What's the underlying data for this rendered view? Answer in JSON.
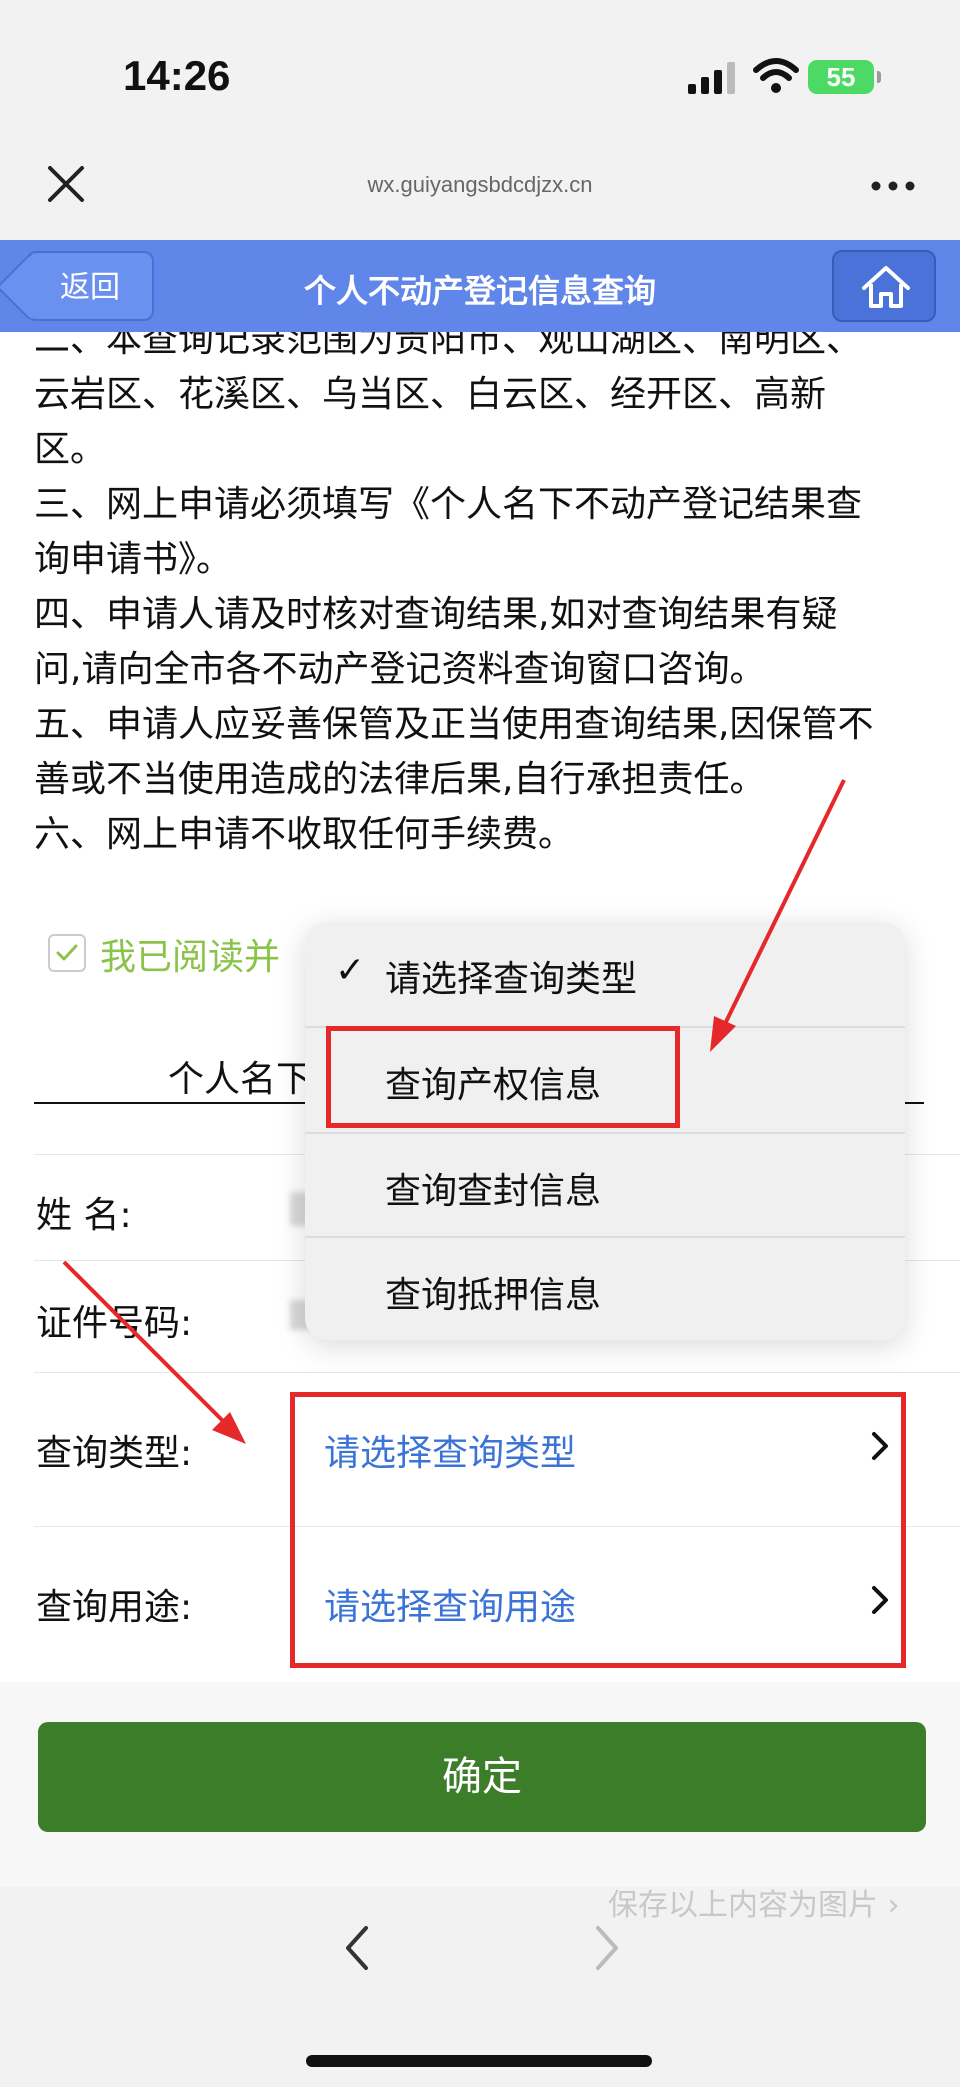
{
  "status_bar": {
    "time": "14:26",
    "battery": "55"
  },
  "browser": {
    "url": "wx.guiyangsbdcdjzx.cn"
  },
  "header": {
    "back_label": "返回",
    "title": "个人不动产登记信息查询"
  },
  "notice": {
    "lines": [
      "二、本查询记录范围为贵阳市、观山湖区、南明区、",
      "云岩区、花溪区、乌当区、白云区、经开区、高新",
      "区。",
      "三、网上申请必须填写《个人名下不动产登记结果查",
      "询申请书》。",
      "四、申请人请及时核对查询结果,如对查询结果有疑",
      "问,请向全市各不动产登记资料查询窗口咨询。",
      "五、申请人应妥善保管及正当使用查询结果,因保管不",
      "善或不当使用造成的法律后果,自行承担责任。",
      "六、网上申请不收取任何手续费。"
    ]
  },
  "agree": {
    "text": "我已阅读并"
  },
  "form": {
    "title": "个人名下",
    "name_label": "姓  名:",
    "id_label": "证件号码:",
    "query_type_label": "查询类型:",
    "query_type_value": "请选择查询类型",
    "query_purpose_label": "查询用途:",
    "query_purpose_value": "请选择查询用途",
    "confirm_label": "确定"
  },
  "dropdown": {
    "options": [
      "请选择查询类型",
      "查询产权信息",
      "查询查封信息",
      "查询抵押信息"
    ],
    "selected_index": 0
  },
  "footer": {
    "save_image": "保存以上内容为图片 ›"
  },
  "colors": {
    "header_bg": "#5f86e8",
    "link_blue": "#3b73d6",
    "confirm_green": "#3b7d28",
    "agree_green": "#8bc34a",
    "annotation_red": "#e5282a"
  }
}
